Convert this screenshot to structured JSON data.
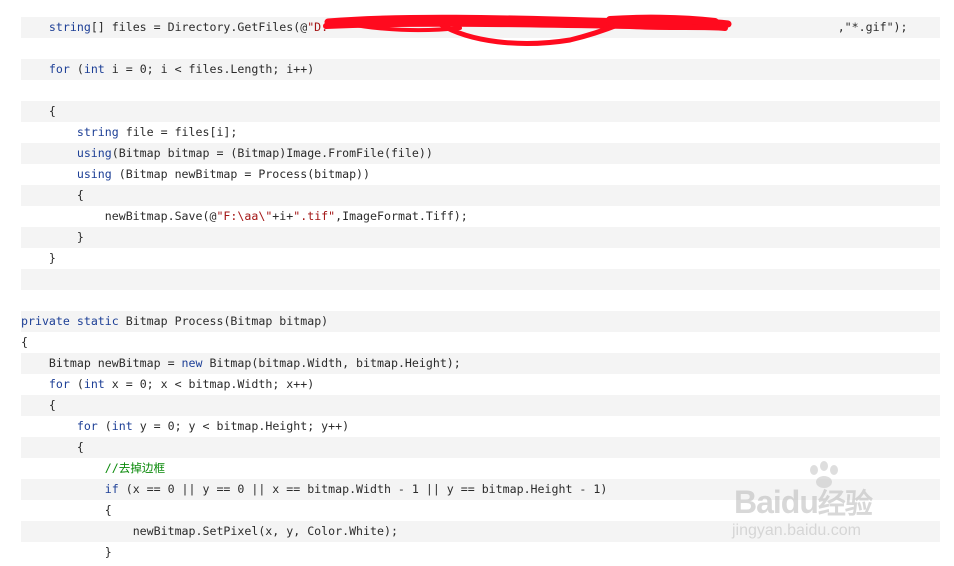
{
  "code": {
    "lines": [
      {
        "indent": "    ",
        "tokens": [
          {
            "k": "kw",
            "t": "string"
          },
          {
            "k": "",
            "t": "[] files = Directory.GetFiles(@"
          },
          {
            "k": "str",
            "t": "\"D:"
          },
          {
            "k": "",
            "t": "                                                                         "
          },
          {
            "k": "",
            "t": ",\"*.gif\");"
          }
        ],
        "shaded": true
      },
      {
        "indent": "",
        "tokens": [],
        "shaded": false
      },
      {
        "indent": "    ",
        "tokens": [
          {
            "k": "kw",
            "t": "for"
          },
          {
            "k": "",
            "t": " ("
          },
          {
            "k": "kw",
            "t": "int"
          },
          {
            "k": "",
            "t": " i = 0; i < files.Length; i++)"
          }
        ],
        "shaded": true
      },
      {
        "indent": "",
        "tokens": [],
        "shaded": false
      },
      {
        "indent": "    ",
        "tokens": [
          {
            "k": "",
            "t": "{"
          }
        ],
        "shaded": true
      },
      {
        "indent": "        ",
        "tokens": [
          {
            "k": "kw",
            "t": "string"
          },
          {
            "k": "",
            "t": " file = files[i];"
          }
        ],
        "shaded": false
      },
      {
        "indent": "        ",
        "tokens": [
          {
            "k": "kw",
            "t": "using"
          },
          {
            "k": "",
            "t": "(Bitmap bitmap = (Bitmap)Image.FromFile(file))"
          }
        ],
        "shaded": true
      },
      {
        "indent": "        ",
        "tokens": [
          {
            "k": "kw",
            "t": "using"
          },
          {
            "k": "",
            "t": " (Bitmap newBitmap = Process(bitmap))"
          }
        ],
        "shaded": false
      },
      {
        "indent": "        ",
        "tokens": [
          {
            "k": "",
            "t": "{"
          }
        ],
        "shaded": true
      },
      {
        "indent": "            ",
        "tokens": [
          {
            "k": "",
            "t": "newBitmap.Save(@"
          },
          {
            "k": "str",
            "t": "\"F:\\aa\\\""
          },
          {
            "k": "",
            "t": "+i+"
          },
          {
            "k": "str",
            "t": "\".tif\""
          },
          {
            "k": "",
            "t": ",ImageFormat.Tiff);"
          }
        ],
        "shaded": false
      },
      {
        "indent": "        ",
        "tokens": [
          {
            "k": "",
            "t": "}"
          }
        ],
        "shaded": true
      },
      {
        "indent": "    ",
        "tokens": [
          {
            "k": "",
            "t": "}"
          }
        ],
        "shaded": false
      },
      {
        "indent": "",
        "tokens": [],
        "shaded": true
      },
      {
        "indent": "",
        "tokens": [],
        "shaded": false
      },
      {
        "indent": "",
        "tokens": [
          {
            "k": "kw",
            "t": "private"
          },
          {
            "k": "",
            "t": " "
          },
          {
            "k": "kw",
            "t": "static"
          },
          {
            "k": "",
            "t": " Bitmap Process(Bitmap bitmap)"
          }
        ],
        "shaded": true
      },
      {
        "indent": "",
        "tokens": [
          {
            "k": "",
            "t": "{"
          }
        ],
        "shaded": false
      },
      {
        "indent": "    ",
        "tokens": [
          {
            "k": "",
            "t": "Bitmap newBitmap = "
          },
          {
            "k": "kw",
            "t": "new"
          },
          {
            "k": "",
            "t": " Bitmap(bitmap.Width, bitmap.Height);"
          }
        ],
        "shaded": true
      },
      {
        "indent": "    ",
        "tokens": [
          {
            "k": "kw",
            "t": "for"
          },
          {
            "k": "",
            "t": " ("
          },
          {
            "k": "kw",
            "t": "int"
          },
          {
            "k": "",
            "t": " x = 0; x < bitmap.Width; x++)"
          }
        ],
        "shaded": false
      },
      {
        "indent": "    ",
        "tokens": [
          {
            "k": "",
            "t": "{"
          }
        ],
        "shaded": true
      },
      {
        "indent": "        ",
        "tokens": [
          {
            "k": "kw",
            "t": "for"
          },
          {
            "k": "",
            "t": " ("
          },
          {
            "k": "kw",
            "t": "int"
          },
          {
            "k": "",
            "t": " y = 0; y < bitmap.Height; y++)"
          }
        ],
        "shaded": false
      },
      {
        "indent": "        ",
        "tokens": [
          {
            "k": "",
            "t": "{"
          }
        ],
        "shaded": true
      },
      {
        "indent": "            ",
        "tokens": [
          {
            "k": "cm",
            "t": "//去掉边框"
          }
        ],
        "shaded": false
      },
      {
        "indent": "            ",
        "tokens": [
          {
            "k": "kw",
            "t": "if"
          },
          {
            "k": "",
            "t": " (x == 0 || y == 0 || x == bitmap.Width - 1 || y == bitmap.Height - 1)"
          }
        ],
        "shaded": true
      },
      {
        "indent": "            ",
        "tokens": [
          {
            "k": "",
            "t": "{"
          }
        ],
        "shaded": false
      },
      {
        "indent": "                ",
        "tokens": [
          {
            "k": "",
            "t": "newBitmap.SetPixel(x, y, Color.White);"
          }
        ],
        "shaded": true
      },
      {
        "indent": "            ",
        "tokens": [
          {
            "k": "",
            "t": "}"
          }
        ],
        "shaded": false
      }
    ]
  },
  "watermark": {
    "brand": "Bai",
    "brand_du": "du",
    "brand_suffix": "经验",
    "url": "jingyan.baidu.com"
  },
  "colors": {
    "keyword": "#1d3f96",
    "string": "#a31515",
    "comment": "#0a8a0a",
    "redaction": "#ff0a1e",
    "shade": "#f4f4f4"
  }
}
